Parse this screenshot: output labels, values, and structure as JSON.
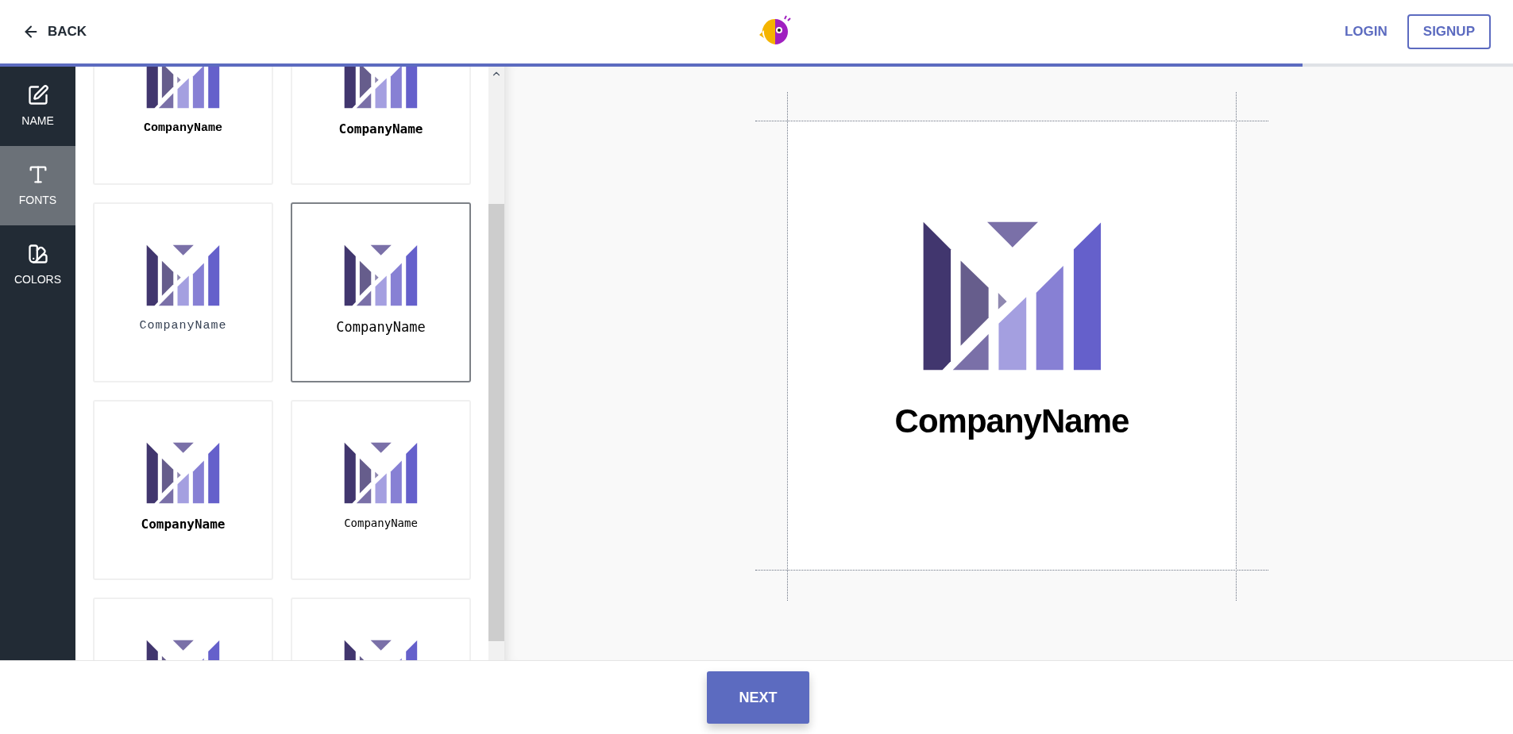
{
  "header": {
    "back": "BACK",
    "login": "LOGIN",
    "signup": "SIGNUP"
  },
  "progress": {
    "level": 0.861
  },
  "sidebar": {
    "items": [
      {
        "label": "NAME",
        "selected": false
      },
      {
        "label": "FONTS",
        "selected": true
      },
      {
        "label": "COLORS",
        "selected": false
      }
    ]
  },
  "font_options": [
    {
      "label": "CompanyName",
      "selected": false
    },
    {
      "label": "CompanyName",
      "selected": false
    },
    {
      "label": "CompanyName",
      "selected": false
    },
    {
      "label": "CompanyName",
      "selected": true
    },
    {
      "label": "CompanyName",
      "selected": false
    },
    {
      "label": "CompanyName",
      "selected": false
    },
    {
      "selected": false
    },
    {
      "selected": false
    }
  ],
  "preview": {
    "company_name": "CompanyName"
  },
  "next_button": "NEXT"
}
